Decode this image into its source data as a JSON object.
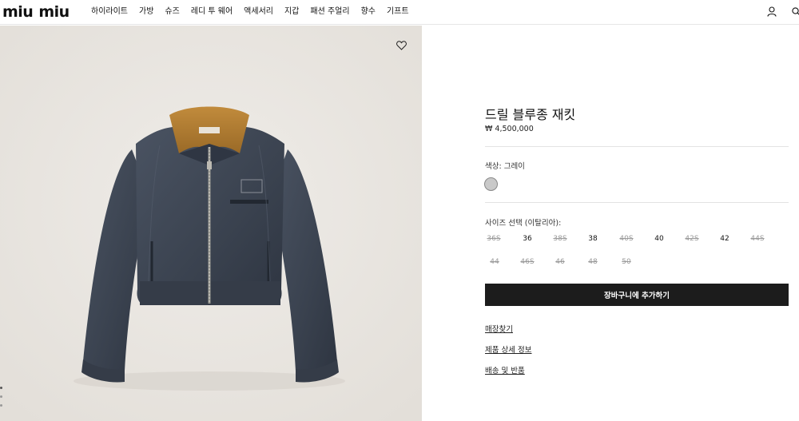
{
  "header": {
    "logo_part1": "miu",
    "logo_part2": "miu",
    "nav": [
      "하이라이트",
      "가방",
      "슈즈",
      "레디 투 웨어",
      "액세서리",
      "지갑",
      "패션 주얼리",
      "향수",
      "기프트"
    ],
    "icons": [
      "account-icon",
      "search-icon"
    ]
  },
  "product": {
    "title": "드릴 블루종 재킷",
    "price": "₩ 4,500,000",
    "color_label": "색상: 그레이",
    "color_swatch": "#c9c9c9",
    "size_label": "사이즈 선택 (이탈리아):",
    "sizes_row1": [
      {
        "label": "36S",
        "available": false
      },
      {
        "label": "36",
        "available": true
      },
      {
        "label": "38S",
        "available": false
      },
      {
        "label": "38",
        "available": true
      },
      {
        "label": "40S",
        "available": false
      },
      {
        "label": "40",
        "available": true
      },
      {
        "label": "42S",
        "available": false
      },
      {
        "label": "42",
        "available": true
      },
      {
        "label": "44S",
        "available": false
      }
    ],
    "sizes_row2": [
      {
        "label": "44",
        "available": false
      },
      {
        "label": "46S",
        "available": false
      },
      {
        "label": "46",
        "available": false
      },
      {
        "label": "48",
        "available": false
      },
      {
        "label": "50",
        "available": false
      }
    ],
    "cart_button": "장바구니에 추가하기",
    "links": [
      "매장찾기",
      "제품 상세 정보",
      "배송 및 반품"
    ]
  },
  "gallery": {
    "image_alt": "jacket-photo",
    "image_count": 3,
    "active_image": 1
  },
  "colors": {
    "background_image": "#ebe8e3",
    "jacket": "#3b4350",
    "collar": "#b07a2e",
    "button_bg": "#1c1c1c"
  }
}
